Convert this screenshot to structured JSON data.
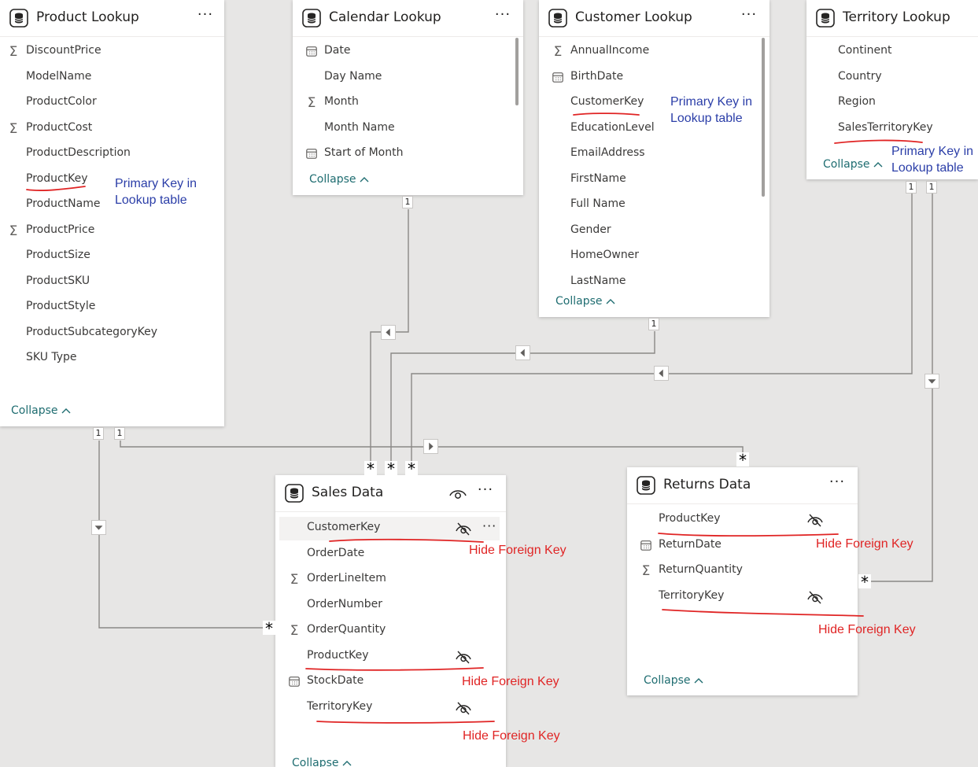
{
  "tables": {
    "product": {
      "title": "Product Lookup",
      "fields": [
        {
          "name": "DiscountPrice",
          "icon": "sigma"
        },
        {
          "name": "ModelName",
          "icon": ""
        },
        {
          "name": "ProductColor",
          "icon": ""
        },
        {
          "name": "ProductCost",
          "icon": "sigma"
        },
        {
          "name": "ProductDescription",
          "icon": ""
        },
        {
          "name": "ProductKey",
          "icon": ""
        },
        {
          "name": "ProductName",
          "icon": ""
        },
        {
          "name": "ProductPrice",
          "icon": "sigma"
        },
        {
          "name": "ProductSize",
          "icon": ""
        },
        {
          "name": "ProductSKU",
          "icon": ""
        },
        {
          "name": "ProductStyle",
          "icon": ""
        },
        {
          "name": "ProductSubcategoryKey",
          "icon": ""
        },
        {
          "name": "SKU Type",
          "icon": ""
        }
      ],
      "collapse": "Collapse"
    },
    "calendar": {
      "title": "Calendar Lookup",
      "fields": [
        {
          "name": "Date",
          "icon": "calendar"
        },
        {
          "name": "Day Name",
          "icon": ""
        },
        {
          "name": "Month",
          "icon": "sigma"
        },
        {
          "name": "Month Name",
          "icon": ""
        },
        {
          "name": "Start of Month",
          "icon": "calendar"
        }
      ],
      "collapse": "Collapse"
    },
    "customer": {
      "title": "Customer Lookup",
      "fields": [
        {
          "name": "AnnualIncome",
          "icon": "sigma"
        },
        {
          "name": "BirthDate",
          "icon": "calendar"
        },
        {
          "name": "CustomerKey",
          "icon": ""
        },
        {
          "name": "EducationLevel",
          "icon": ""
        },
        {
          "name": "EmailAddress",
          "icon": ""
        },
        {
          "name": "FirstName",
          "icon": ""
        },
        {
          "name": "Full Name",
          "icon": ""
        },
        {
          "name": "Gender",
          "icon": ""
        },
        {
          "name": "HomeOwner",
          "icon": ""
        },
        {
          "name": "LastName",
          "icon": ""
        }
      ],
      "collapse": "Collapse"
    },
    "territory": {
      "title": "Territory Lookup",
      "fields": [
        {
          "name": "Continent",
          "icon": ""
        },
        {
          "name": "Country",
          "icon": ""
        },
        {
          "name": "Region",
          "icon": ""
        },
        {
          "name": "SalesTerritoryKey",
          "icon": ""
        }
      ],
      "collapse": "Collapse"
    },
    "sales": {
      "title": "Sales Data",
      "fields": [
        {
          "name": "CustomerKey",
          "icon": "",
          "hidden": true
        },
        {
          "name": "OrderDate",
          "icon": ""
        },
        {
          "name": "OrderLineItem",
          "icon": "sigma"
        },
        {
          "name": "OrderNumber",
          "icon": ""
        },
        {
          "name": "OrderQuantity",
          "icon": "sigma"
        },
        {
          "name": "ProductKey",
          "icon": "",
          "hidden": true
        },
        {
          "name": "StockDate",
          "icon": "calendar"
        },
        {
          "name": "TerritoryKey",
          "icon": "",
          "hidden": true
        }
      ],
      "collapse": "Collapse"
    },
    "returns": {
      "title": "Returns Data",
      "fields": [
        {
          "name": "ProductKey",
          "icon": "",
          "hidden": true
        },
        {
          "name": "ReturnDate",
          "icon": "calendar"
        },
        {
          "name": "ReturnQuantity",
          "icon": "sigma"
        },
        {
          "name": "TerritoryKey",
          "icon": "",
          "hidden": true
        }
      ],
      "collapse": "Collapse"
    }
  },
  "icons": {
    "sigma": "Σ",
    "more": "···"
  },
  "cardinality": {
    "one": "1",
    "many": "*"
  },
  "annotations": {
    "primary_key": "Primary Key in\nLookup table",
    "hide_foreign_key": "Hide Foreign Key"
  },
  "colors": {
    "canvas": "#e7e6e5",
    "annotation_blue": "#2b3ea8",
    "annotation_red": "#e02424",
    "collapse_teal": "#1f6d71"
  }
}
